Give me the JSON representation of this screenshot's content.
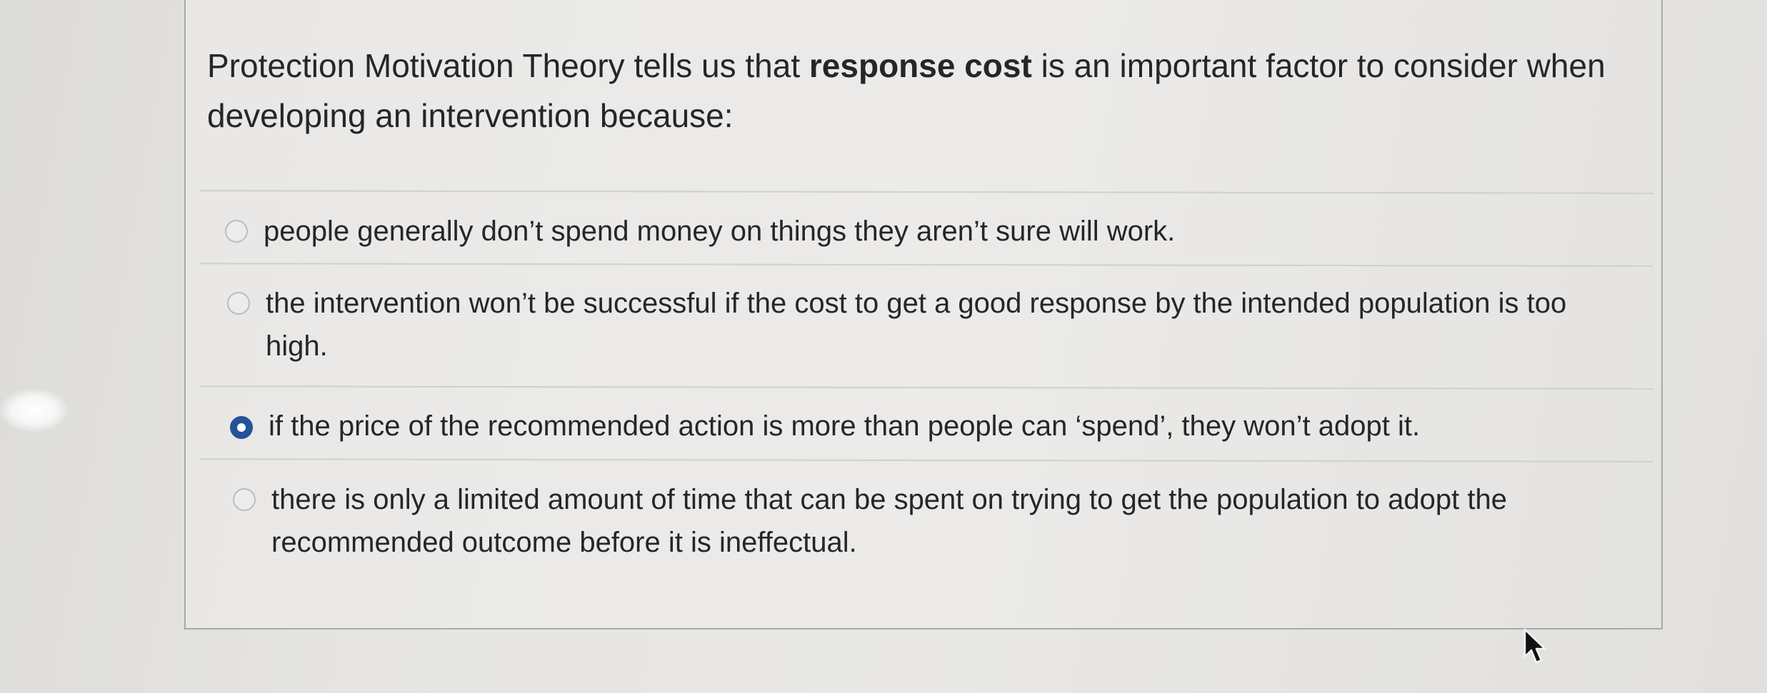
{
  "question": {
    "prefix": "Protection Motivation Theory tells us that",
    "emphasis": "response cost",
    "suffix": "is an important factor to consider when developing an intervention because:"
  },
  "options": [
    {
      "label": "people generally don’t spend money on things they aren’t sure will work.",
      "selected": false
    },
    {
      "label": "the intervention won’t be successful if the cost to get a good response by the intended population is too high.",
      "selected": false
    },
    {
      "label": "if the price of the recommended action is more than people can ‘spend’, they won’t adopt it.",
      "selected": true
    },
    {
      "label": "there is only a limited amount of time that can be spent on trying to get the population to adopt the recommended outcome before it is ineffectual.",
      "selected": false
    }
  ],
  "colors": {
    "selected_radio": "#24539a",
    "border": "#a9a9a7"
  },
  "icons": {
    "pointer": "mouse-pointer-icon"
  }
}
